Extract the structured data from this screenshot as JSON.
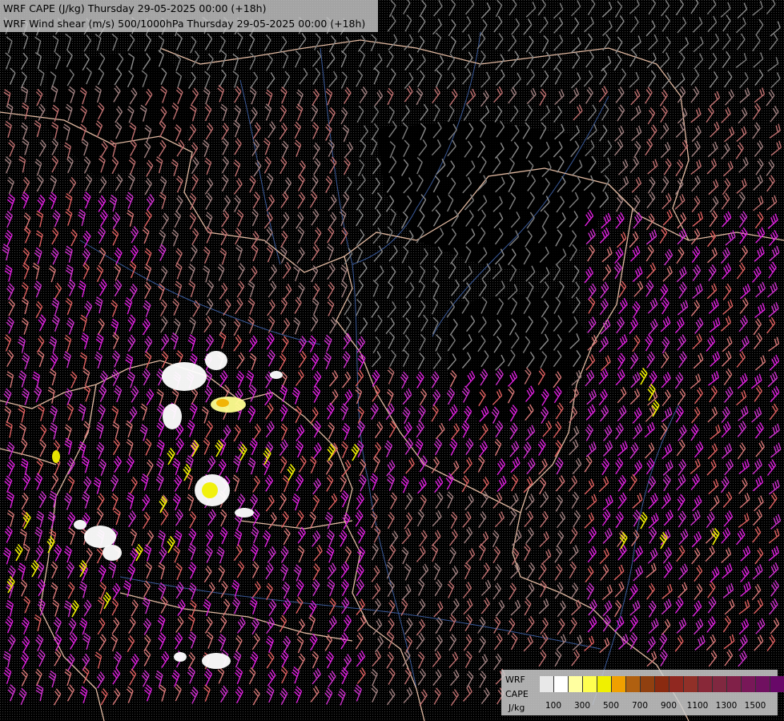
{
  "header": {
    "line1": "WRF CAPE (J/kg) Thursday 29-05-2025 00:00 (+18h)",
    "line2": "WRF Wind shear (m/s) 500/1000hPa Thursday 29-05-2025 00:00 (+18h)"
  },
  "legend": {
    "title1": "WRF",
    "title2": "CAPE",
    "unit": "J/kg",
    "colors": [
      "#e8e8e8",
      "#ffffff",
      "#ffffa0",
      "#ffff50",
      "#f0f000",
      "#f0a000",
      "#b06010",
      "#904010",
      "#8a2a10",
      "#902820",
      "#903028",
      "#882838",
      "#802840",
      "#802048",
      "#781858",
      "#701060",
      "#680868",
      "#600070"
    ],
    "ticks": [
      "100",
      "300",
      "500",
      "700",
      "900",
      "1100",
      "1300",
      "1500"
    ]
  },
  "map": {
    "barb_colors": [
      "#7f7f7f",
      "#8c8c8c",
      "#a08080",
      "#c07070",
      "#d87878",
      "#e06060",
      "#d030d0",
      "#e020e0"
    ],
    "cape_fill": "#ffffff",
    "cape_high": "#f0f000",
    "border_color": "#e0b8a0",
    "river_color": "#4060a0"
  }
}
